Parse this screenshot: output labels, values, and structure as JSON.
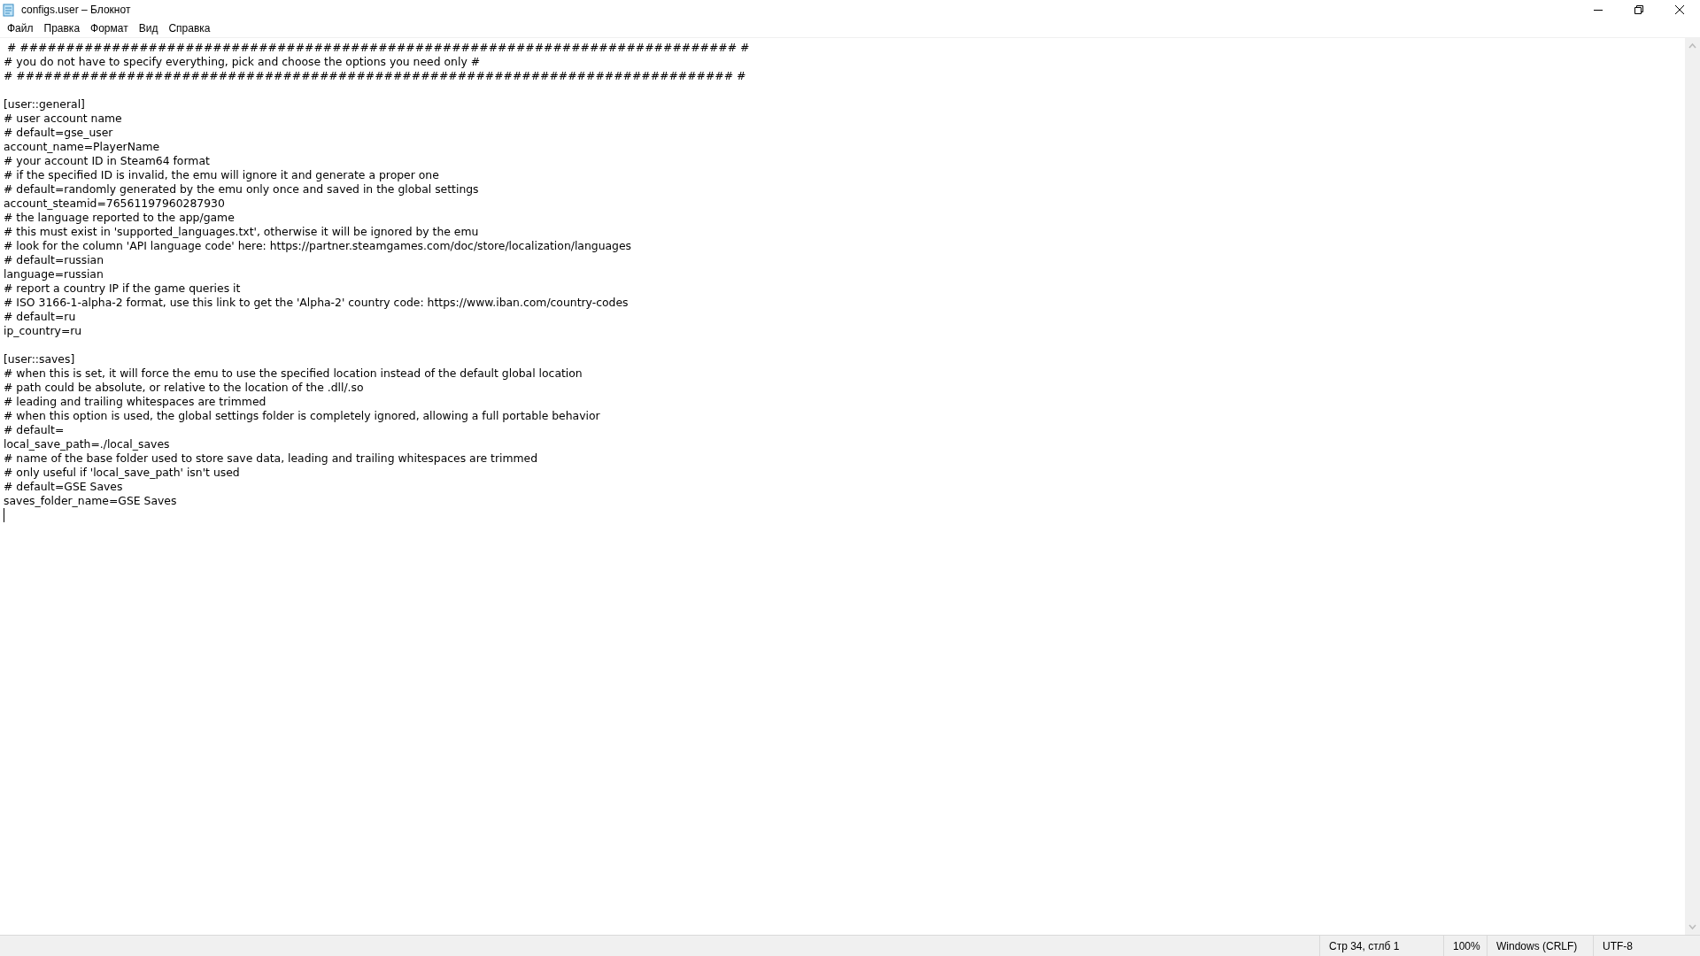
{
  "window": {
    "title": "configs.user – Блокнот"
  },
  "menu": [
    "Файл",
    "Правка",
    "Формат",
    "Вид",
    "Справка"
  ],
  "editor": {
    "blocks": [
      [
        " # ############################################################################## #",
        "# you do not have to specify everything, pick and choose the options you need only #",
        "# ############################################################################## #"
      ],
      [
        "[user::general]",
        "# user account name",
        "# default=gse_user",
        "account_name=PlayerName",
        "# your account ID in Steam64 format",
        "# if the specified ID is invalid, the emu will ignore it and generate a proper one",
        "# default=randomly generated by the emu only once and saved in the global settings",
        "account_steamid=76561197960287930",
        "# the language reported to the app/game",
        "# this must exist in 'supported_languages.txt', otherwise it will be ignored by the emu",
        "# look for the column 'API language code' here: https://partner.steamgames.com/doc/store/localization/languages",
        "# default=russian",
        "language=russian",
        "# report a country IP if the game queries it",
        "# ISO 3166-1-alpha-2 format, use this link to get the 'Alpha-2' country code: https://www.iban.com/country-codes",
        "# default=ru",
        "ip_country=ru"
      ],
      [
        "[user::saves]",
        "# when this is set, it will force the emu to use the specified location instead of the default global location",
        "# path could be absolute, or relative to the location of the .dll/.so",
        "# leading and trailing whitespaces are trimmed",
        "# when this option is used, the global settings folder is completely ignored, allowing a full portable behavior",
        "# default=",
        "local_save_path=./local_saves",
        "# name of the base folder used to store save data, leading and trailing whitespaces are trimmed",
        "# only useful if 'local_save_path' isn't used",
        "# default=GSE Saves",
        "saves_folder_name=GSE Saves"
      ]
    ]
  },
  "status_bar": [
    "Стр 34, стлб 1",
    "100%",
    "Windows (CRLF)",
    "UTF-8"
  ]
}
